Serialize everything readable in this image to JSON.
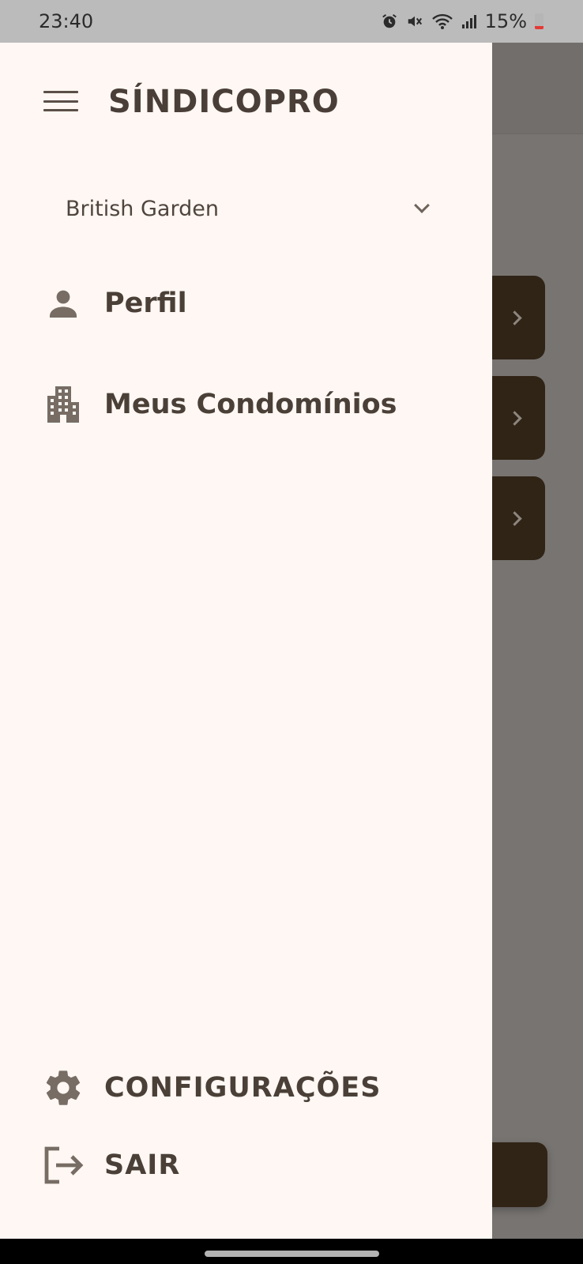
{
  "status_bar": {
    "time": "23:40",
    "battery": "15%",
    "icons": [
      "alarm-icon",
      "mute-icon",
      "wifi-icon",
      "signal-icon",
      "battery-icon"
    ]
  },
  "drawer": {
    "brand": "SÍNDICOPRO",
    "condo_selector": {
      "selected": "British Garden"
    },
    "items": [
      {
        "label": "Perfil",
        "icon": "person-icon"
      },
      {
        "label": "Meus Condomínios",
        "icon": "building-icon"
      }
    ],
    "footer_items": [
      {
        "label": "CONFIGURAÇÕES",
        "icon": "gear-icon"
      },
      {
        "label": "SAIR",
        "icon": "logout-icon"
      }
    ]
  },
  "colors": {
    "drawer_bg": "#fff7f3",
    "text_primary": "#4a4038",
    "icon": "#776d65",
    "scrim": "#777471",
    "card_dark": "#302416"
  }
}
